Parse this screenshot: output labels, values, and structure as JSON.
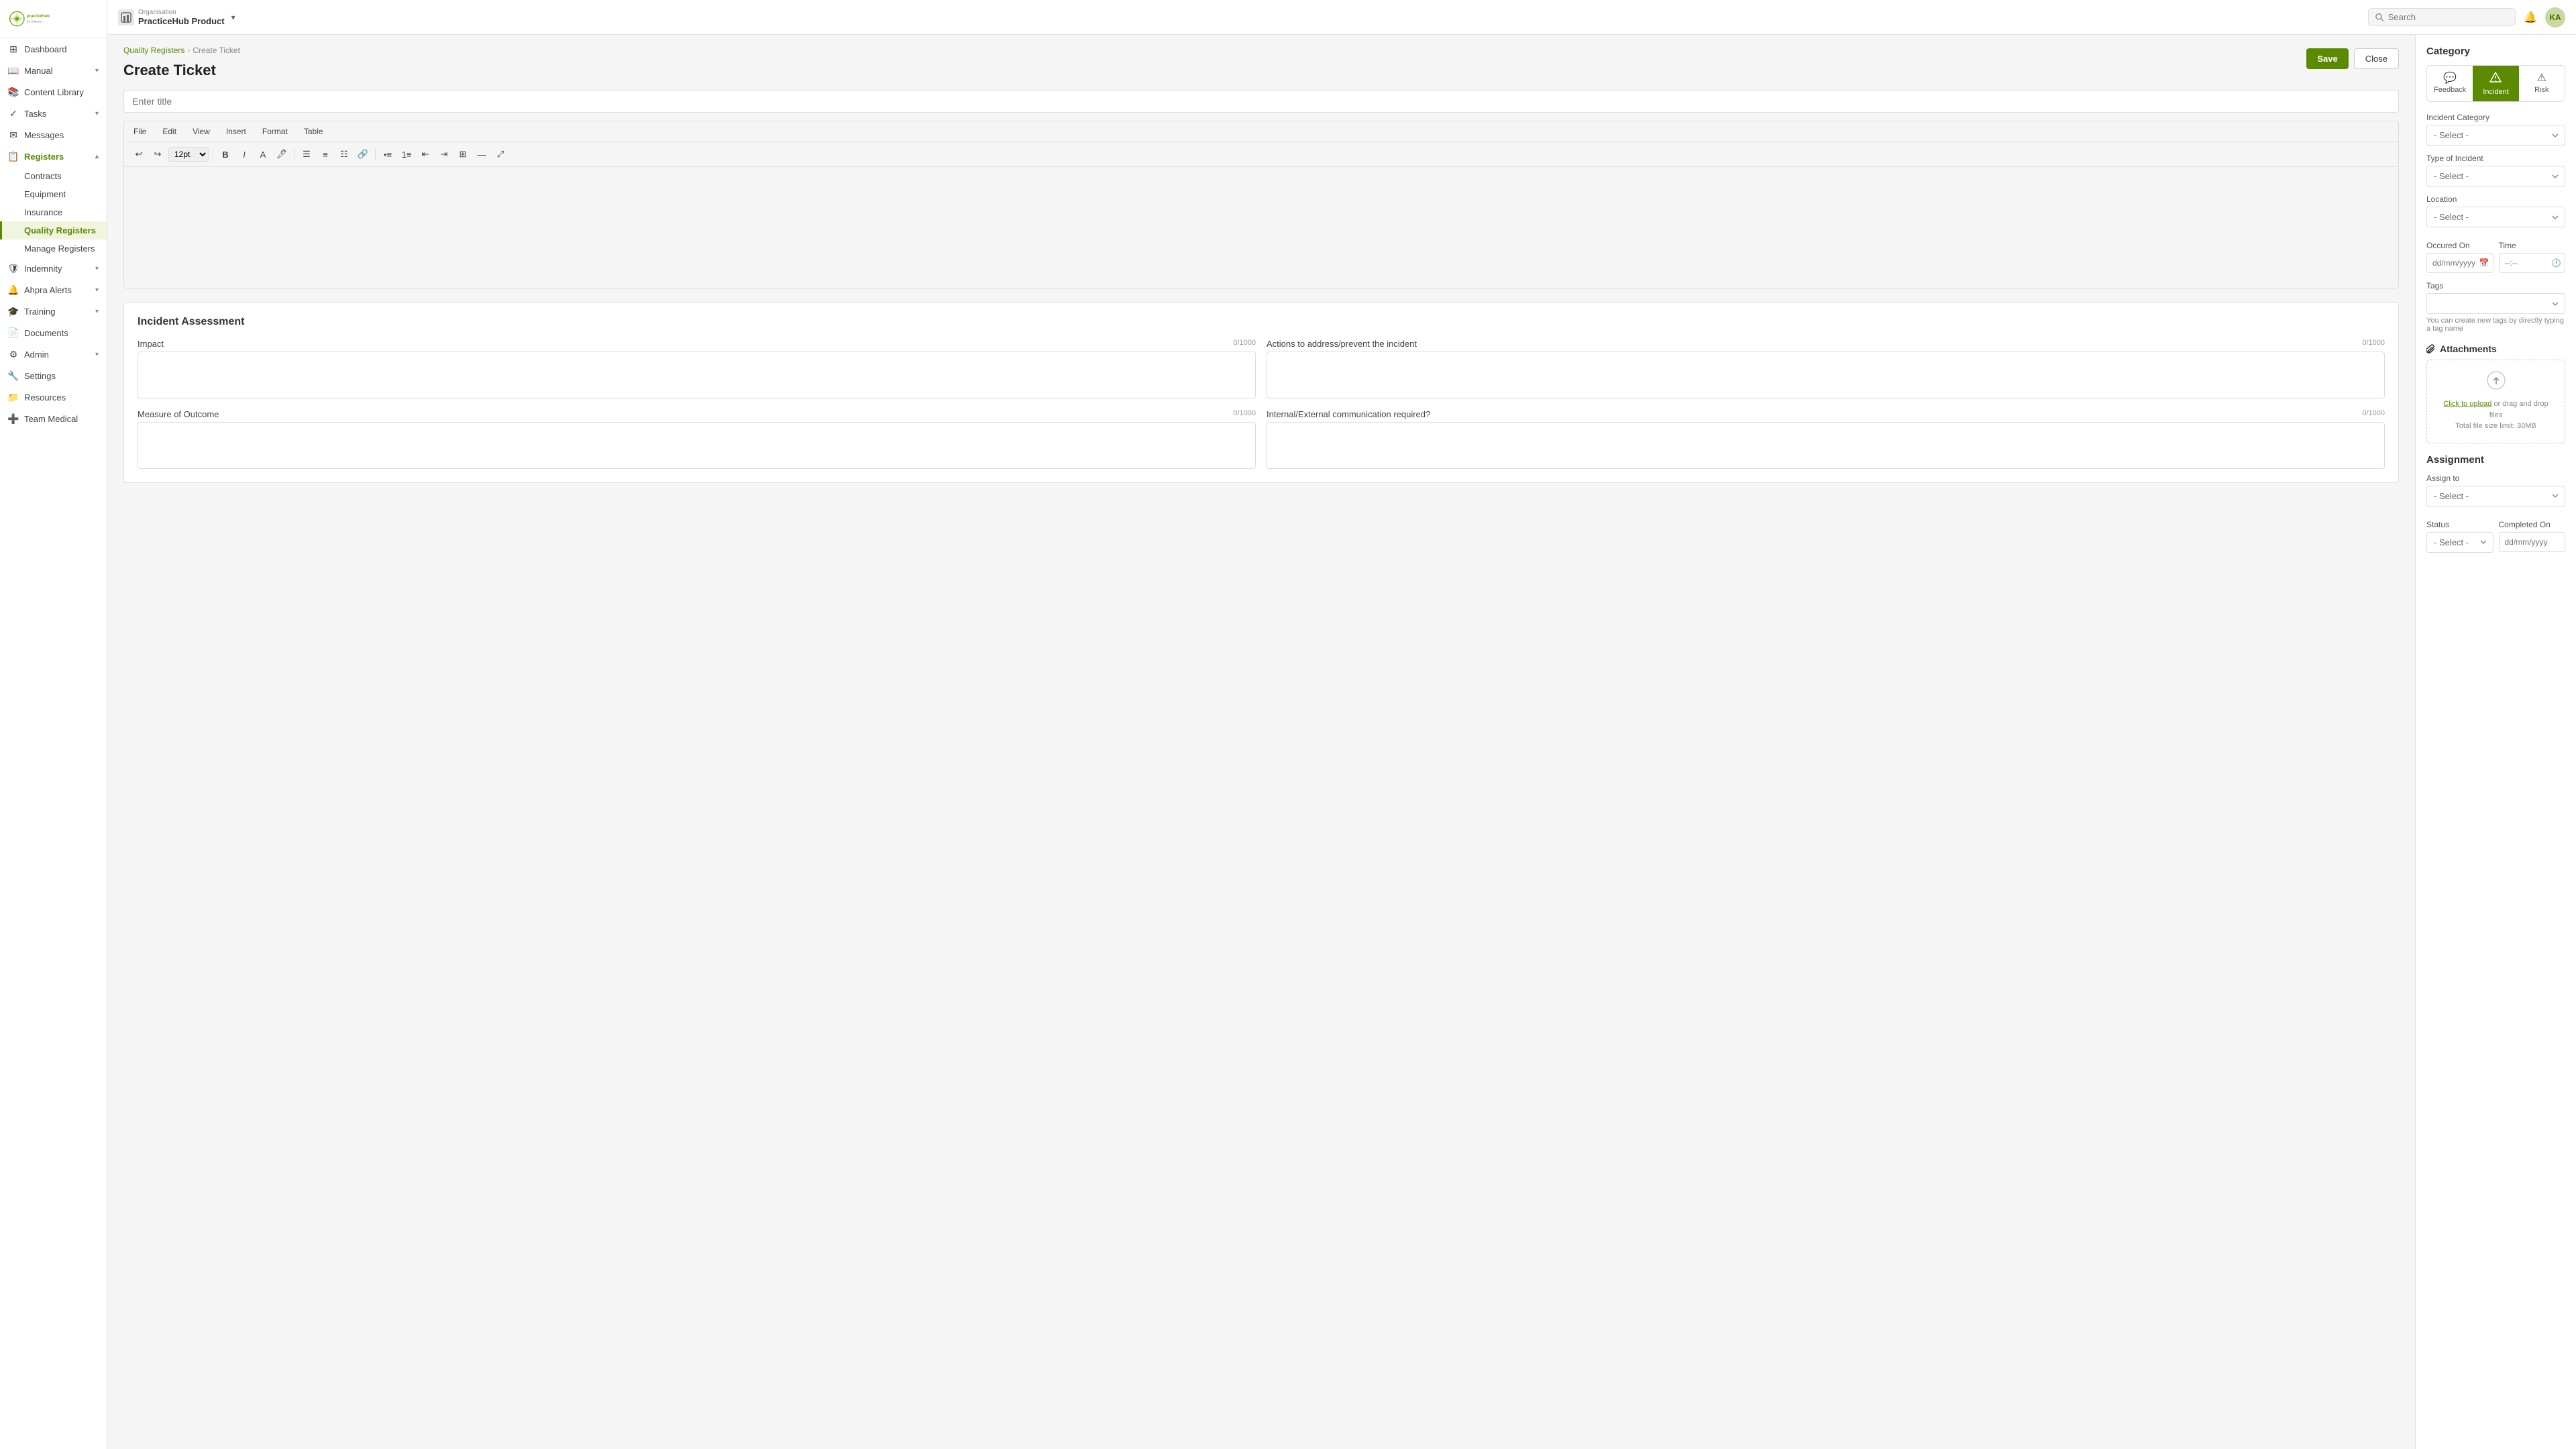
{
  "app": {
    "logo_text": "practicehub",
    "org_label": "Organisation",
    "org_name": "PracticeHub Product",
    "search_placeholder": "Search",
    "avatar_initials": "KA"
  },
  "sidebar": {
    "items": [
      {
        "id": "dashboard",
        "label": "Dashboard",
        "icon": "⊞",
        "has_children": false
      },
      {
        "id": "manual",
        "label": "Manual",
        "icon": "📖",
        "has_children": true
      },
      {
        "id": "content-library",
        "label": "Content Library",
        "icon": "📚",
        "has_children": false
      },
      {
        "id": "tasks",
        "label": "Tasks",
        "icon": "✓",
        "has_children": true
      },
      {
        "id": "messages",
        "label": "Messages",
        "icon": "✉",
        "has_children": false
      },
      {
        "id": "registers",
        "label": "Registers",
        "icon": "📋",
        "has_children": true,
        "active": true
      },
      {
        "id": "indemnity",
        "label": "Indemnity",
        "icon": "🛡",
        "has_children": true
      },
      {
        "id": "ahpra-alerts",
        "label": "Ahpra Alerts",
        "icon": "🔔",
        "has_children": true
      },
      {
        "id": "training",
        "label": "Training",
        "icon": "🎓",
        "has_children": true
      },
      {
        "id": "documents",
        "label": "Documents",
        "icon": "📄",
        "has_children": false
      },
      {
        "id": "admin",
        "label": "Admin",
        "icon": "⚙",
        "has_children": true
      },
      {
        "id": "settings",
        "label": "Settings",
        "icon": "🔧",
        "has_children": false
      },
      {
        "id": "resources",
        "label": "Resources",
        "icon": "📁",
        "has_children": false
      },
      {
        "id": "team-medical",
        "label": "Team Medical",
        "icon": "➕",
        "has_children": false
      }
    ],
    "registers_sub": [
      {
        "id": "contracts",
        "label": "Contracts"
      },
      {
        "id": "equipment",
        "label": "Equipment"
      },
      {
        "id": "insurance",
        "label": "Insurance"
      },
      {
        "id": "quality-registers",
        "label": "Quality Registers",
        "active": true
      },
      {
        "id": "manage-registers",
        "label": "Manage Registers"
      }
    ]
  },
  "breadcrumb": {
    "parent": "Quality Registers",
    "current": "Create Ticket"
  },
  "page": {
    "title": "Create Ticket",
    "save_label": "Save",
    "close_label": "Close"
  },
  "editor": {
    "title_placeholder": "Enter title",
    "menu_items": [
      "File",
      "Edit",
      "View",
      "Insert",
      "Format",
      "Table"
    ],
    "font_size": "12pt"
  },
  "incident_assessment": {
    "section_title": "Incident Assessment",
    "fields": [
      {
        "id": "impact",
        "label": "Impact",
        "count": "0/1000"
      },
      {
        "id": "actions",
        "label": "Actions to address/prevent the incident",
        "count": "0/1000"
      },
      {
        "id": "measure",
        "label": "Measure of Outcome",
        "count": "0/1000"
      },
      {
        "id": "communication",
        "label": "Internal/External communication required?",
        "count": "0/1000"
      }
    ]
  },
  "right_panel": {
    "category_title": "Category",
    "tabs": [
      {
        "id": "feedback",
        "label": "Feedback",
        "icon": "💬"
      },
      {
        "id": "incident",
        "label": "Incident",
        "icon": "⚠",
        "active": true
      },
      {
        "id": "risk",
        "label": "Risk",
        "icon": "⚠"
      }
    ],
    "incident_category_label": "Incident Category",
    "incident_category_placeholder": "- Select -",
    "type_of_incident_label": "Type of Incident",
    "type_of_incident_placeholder": "- Select -",
    "location_label": "Location",
    "location_placeholder": "- Select -",
    "occurred_on_label": "Occured On",
    "occurred_on_placeholder": "dd/mm/yyyy",
    "time_label": "Time",
    "time_placeholder": "--:--",
    "tags_label": "Tags",
    "tags_placeholder": "",
    "tags_help": "You can create new tags by directly typing a tag name",
    "attachments_title": "Attachments",
    "upload_text_before": "Click to upload",
    "upload_text_after": " or drag and drop files\nTotal file size limit: 30MB",
    "assignment_title": "Assignment",
    "assign_to_label": "Assign to",
    "assign_to_placeholder": "- Select -",
    "status_label": "Status",
    "completed_on_label": "Completed On"
  }
}
